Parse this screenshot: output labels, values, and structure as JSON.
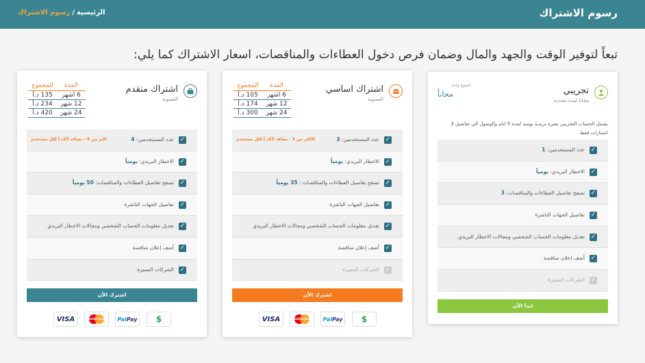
{
  "header": {
    "title": "رسوم الاشتراك",
    "breadcrumb": {
      "home": "الرئيسية",
      "separator": "/",
      "current": "رسوم الاشتراك"
    }
  },
  "headline": "تبعاً لتوفير الوقت والجهد والمال وضمان فرص دخول العطاءات والمناقصات، اسعار الاشتراك كما يلي:",
  "colors": {
    "topbar": "#3b8592",
    "orange": "#f47b20",
    "green": "#8cc63f",
    "teal_button": "#3b8592"
  },
  "price_headers": {
    "duration": "المدة",
    "total": "المجموع"
  },
  "plans": {
    "trial": {
      "name": "تجريبي",
      "subtitle": "مجانا لمدة محددة",
      "price_tag": "اسبوع واحد",
      "price": "مجاناً",
      "description": "يشمل الحساب التجريبي نشرة بريدية يومية لمدة 5 ايام والوصول الى تفاصيل 3 اشعارات فقط.",
      "icon": "user-icon",
      "features": [
        {
          "label": "عدد المستخدمين:",
          "value": "1",
          "enabled": true
        },
        {
          "label": "الاخطار البريدي:",
          "value": "يومياً",
          "enabled": true
        },
        {
          "label": "تصفح تفاصيل العطاءات والمناقصات:",
          "value": "3",
          "enabled": true
        },
        {
          "label": "تفاصيل الجهات الناشرة",
          "value": "",
          "enabled": true
        },
        {
          "label": "تعديل معلومات الحساب الشخصي ومجالات الاخطار البريدي.",
          "value": "",
          "enabled": true
        },
        {
          "label": "أضف إعلان مناقصة",
          "value": "",
          "enabled": true
        },
        {
          "label": "الشركات المميزة",
          "value": "",
          "enabled": false
        }
      ],
      "cta": "ابدأ الآن"
    },
    "basic": {
      "name": "اشتراك اساسي",
      "subtitle": "العضوية",
      "icon": "group-icon",
      "prices": [
        {
          "duration": "6 اشهر",
          "total": "105 د.أ"
        },
        {
          "duration": "12 شهر",
          "total": "174 د.أ"
        },
        {
          "duration": "24 شهر",
          "total": "300 د.أ"
        }
      ],
      "features": [
        {
          "label": "عدد المستخدمين:",
          "value": "3",
          "note": "الاكثر من 3 - يضاف 25د.أ لكل مستخدم",
          "enabled": true
        },
        {
          "label": "الاخطار البريدي:",
          "value": "يومياً",
          "enabled": true
        },
        {
          "label": "تصفح تفاصيل العطاءات والمناقصات :",
          "value": "35 يومياً",
          "enabled": true
        },
        {
          "label": "تفاصيل الجهات الناشرة",
          "value": "",
          "enabled": true
        },
        {
          "label": "تعديل معلومات الحساب الشخصي ومجالات الاخطار البريدي",
          "value": "",
          "enabled": true
        },
        {
          "label": "أضف إعلان مناقصة",
          "value": "",
          "enabled": true
        },
        {
          "label": "الشركات المميزة",
          "value": "",
          "enabled": false
        }
      ],
      "cta": "اشترك الآن"
    },
    "advanced": {
      "name": "اشتراك متقدم",
      "subtitle": "العضوية",
      "icon": "briefcase-icon",
      "prices": [
        {
          "duration": "6 اشهر",
          "total": "135 د.أ"
        },
        {
          "duration": "12 شهر",
          "total": "234 د.أ"
        },
        {
          "duration": "24 شهر",
          "total": "420 د.أ"
        }
      ],
      "features": [
        {
          "label": "عدد المستخدمين:",
          "value": "4",
          "note": "اكثر من 4 - يضاف 25د.أ لكل مستخدم",
          "enabled": true
        },
        {
          "label": "الاخطار البريدي:",
          "value": "يومياً",
          "enabled": true
        },
        {
          "label": "تصفح تفاصيل العطاءات والمناقصات:",
          "value": "50 يومياً",
          "enabled": true
        },
        {
          "label": "تفاصيل الجهات الناشرة",
          "value": "",
          "enabled": true
        },
        {
          "label": "تعديل معلومات الحساب الشخصي ومجالات الاخطار البريدي",
          "value": "",
          "enabled": true
        },
        {
          "label": "أضف إعلان مناقصة",
          "value": "",
          "enabled": true
        },
        {
          "label": "الشركات المميزة",
          "value": "",
          "enabled": true
        }
      ],
      "cta": "اشترك الآن"
    }
  },
  "payments": {
    "visa": "VISA",
    "mastercard": "MasterCard",
    "paypal_a": "Pay",
    "paypal_b": "Pal",
    "cash": "$"
  }
}
